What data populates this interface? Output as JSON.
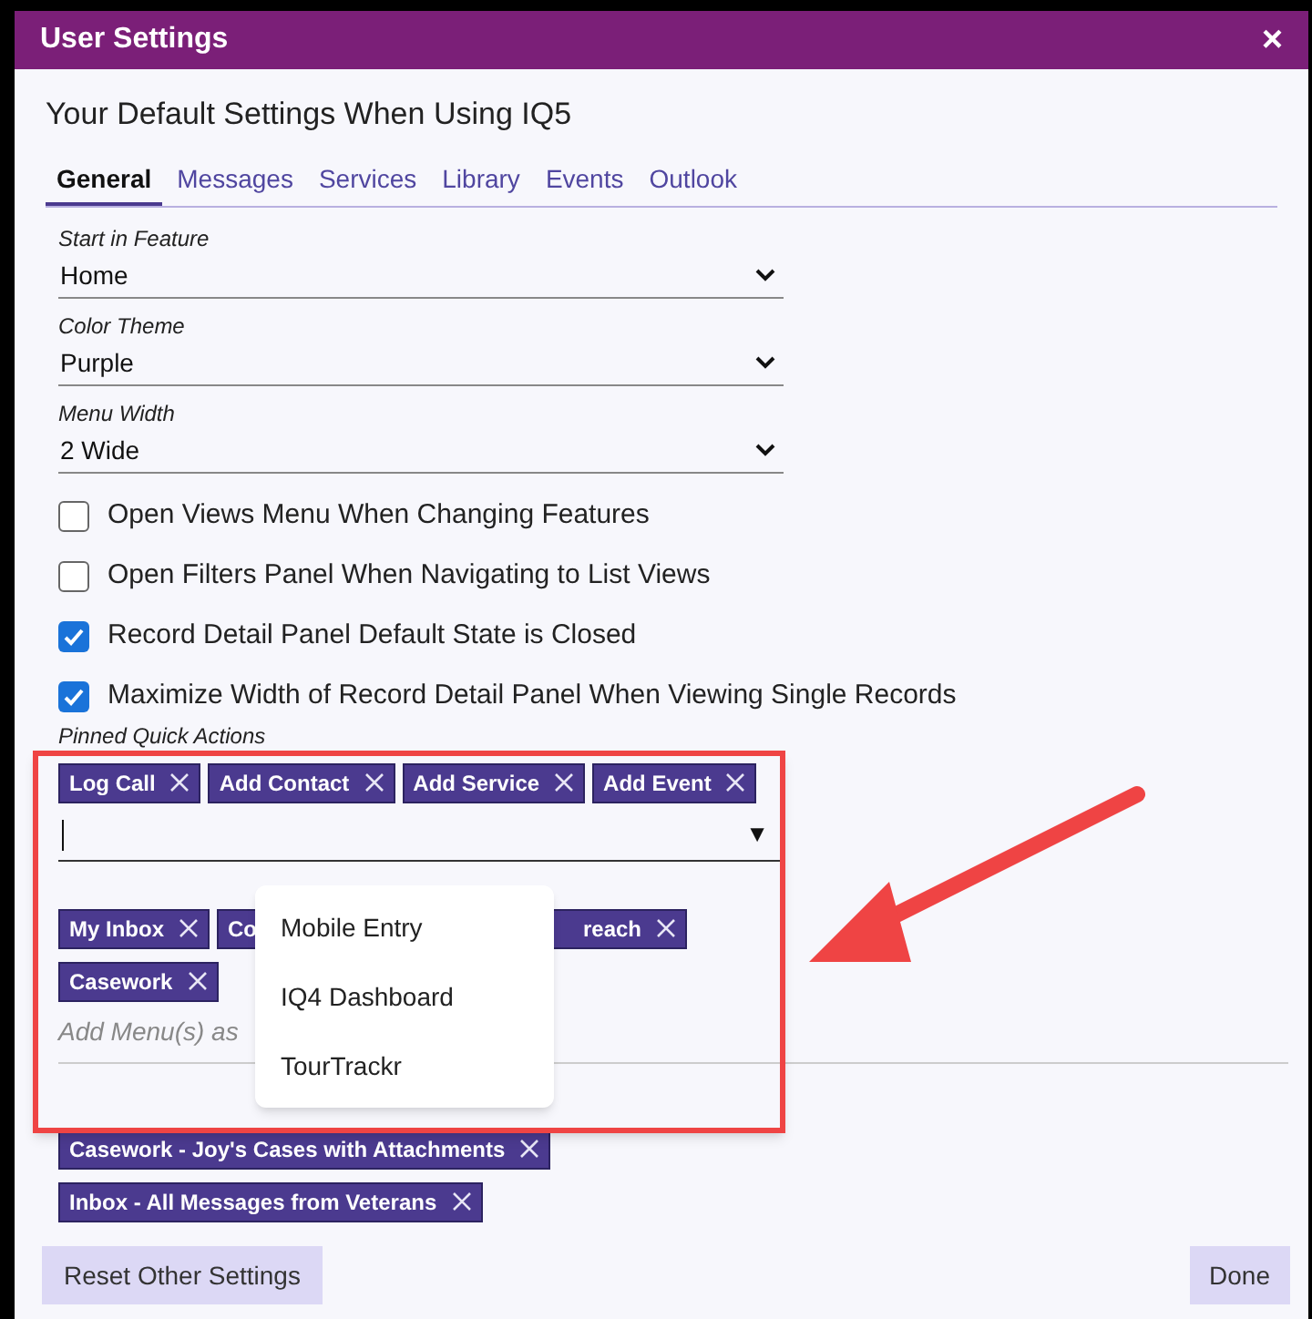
{
  "window": {
    "title": "User Settings",
    "close": "×"
  },
  "heading": "Your Default Settings When Using IQ5",
  "tabs": [
    {
      "label": "General",
      "selected": true
    },
    {
      "label": "Messages",
      "selected": false
    },
    {
      "label": "Services",
      "selected": false
    },
    {
      "label": "Library",
      "selected": false
    },
    {
      "label": "Events",
      "selected": false
    },
    {
      "label": "Outlook",
      "selected": false
    }
  ],
  "selects": [
    {
      "label": "Start in Feature",
      "value": "Home"
    },
    {
      "label": "Color Theme",
      "value": "Purple"
    },
    {
      "label": "Menu Width",
      "value": "2 Wide"
    }
  ],
  "checkboxes": [
    {
      "label": "Open Views Menu When Changing Features",
      "checked": false
    },
    {
      "label": "Open Filters Panel When Navigating to List Views",
      "checked": false
    },
    {
      "label": "Record Detail Panel Default State is Closed",
      "checked": true
    },
    {
      "label": "Maximize Width of Record Detail Panel When Viewing Single Records",
      "checked": true
    }
  ],
  "pinned_quick_actions": {
    "label": "Pinned Quick Actions",
    "tags": [
      "Log Call",
      "Add Contact",
      "Add Service",
      "Add Event"
    ],
    "dropdown_arrow": "▼"
  },
  "pinned_menus": {
    "tags": [
      "My Inbox",
      "Co",
      "reach",
      "Casework"
    ],
    "placeholder": "Add Menu(s) as"
  },
  "dropdown": {
    "options": [
      "Mobile Entry",
      "IQ4 Dashboard",
      "TourTrackr"
    ]
  },
  "pinned_views": {
    "tags": [
      "Casework - Joy's Cases with Attachments",
      "Inbox - All Messages from Veterans"
    ]
  },
  "buttons": {
    "reset": "Reset Other Settings",
    "done": "Done"
  }
}
